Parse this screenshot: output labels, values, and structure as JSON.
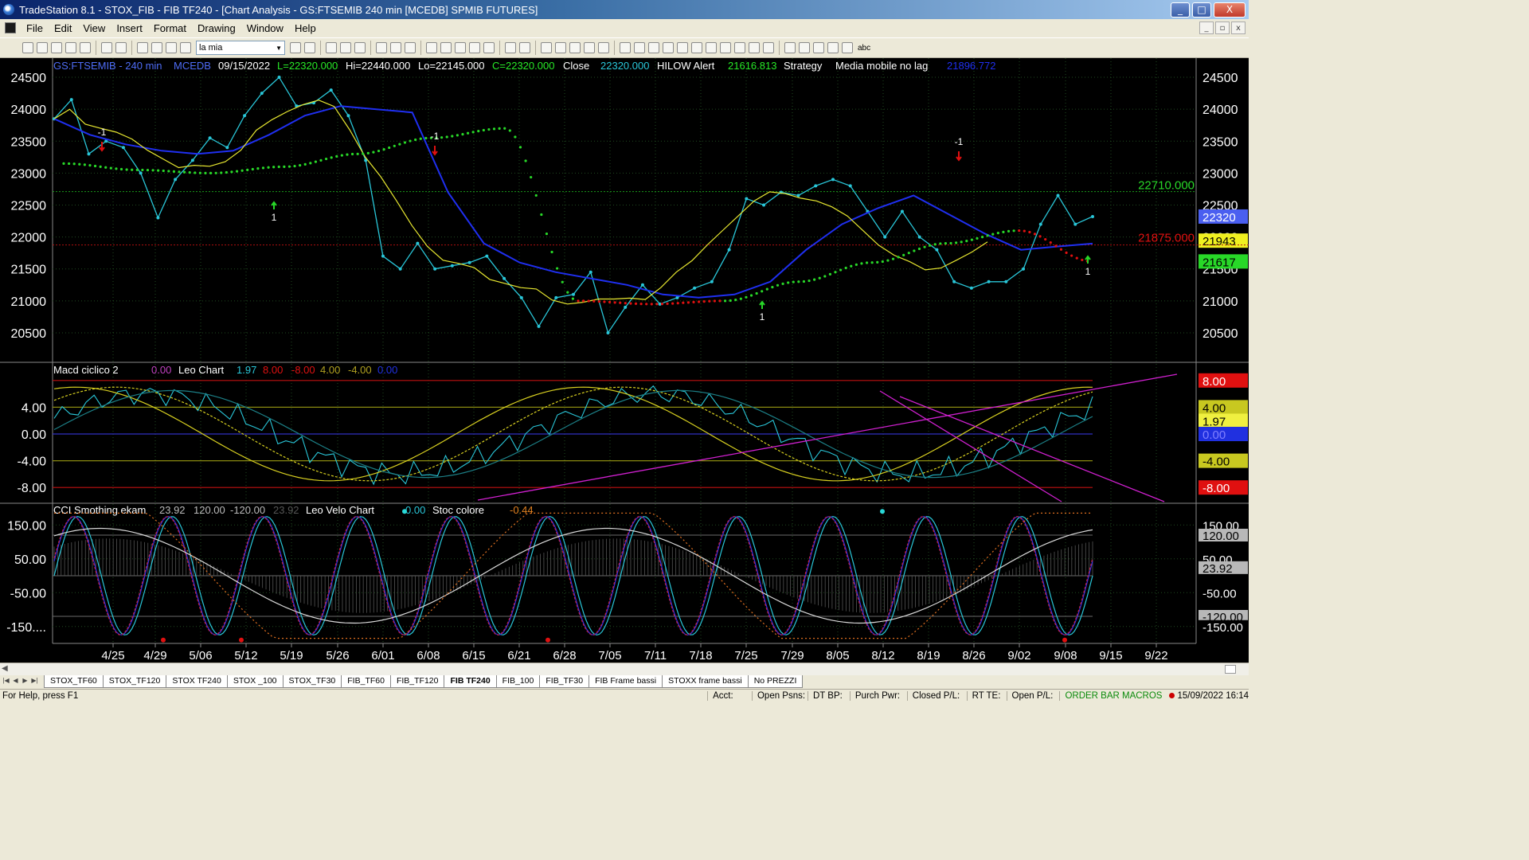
{
  "window": {
    "title": "TradeStation 8.1 - STOX_FIB - FIB TF240 - [Chart Analysis - GS:FTSEMIB  240 min  [MCEDB] SPMIB FUTURES]",
    "min_glyph": "_",
    "max_glyph": "□",
    "close_glyph": "X"
  },
  "menu": {
    "items": [
      "File",
      "Edit",
      "View",
      "Insert",
      "Format",
      "Drawing",
      "Window",
      "Help"
    ],
    "mdi_controls": [
      "_",
      "▫",
      "x"
    ]
  },
  "toolbar": {
    "symbol_dropdown": "la mia",
    "dropdown_arrow": "▼",
    "text_tool": "abc"
  },
  "price_panel": {
    "header": {
      "symbol": "GS:FTSEMIB - 240 min",
      "source": "MCEDB",
      "date": "09/15/2022",
      "low": "L=22320.000",
      "high": "Hi=22440.000",
      "lo": "Lo=22145.000",
      "close_val": "C=22320.000",
      "close_label": "Close",
      "close_value": "22320.000",
      "hilow_label": "HILOW Alert",
      "hilow_value": "21616.813",
      "strategy_label": "Strategy",
      "media_label": "Media mobile no lag",
      "media_value": "21896.772"
    },
    "y_ticks": [
      "24500",
      "24000",
      "23500",
      "23000",
      "22500",
      "22000",
      "21500",
      "21000",
      "20500"
    ],
    "line_labels": {
      "upper": "22710.000",
      "lower": "21875.000"
    },
    "right_markers": [
      "22320",
      "21943",
      "21617"
    ],
    "signal_labels": [
      "-1",
      "1",
      "-1",
      "1",
      "-1",
      "1"
    ]
  },
  "macd_panel": {
    "header": {
      "name": "Macd ciclico 2",
      "v1": "0.00",
      "leo": "Leo Chart",
      "v2": "1.97",
      "v3": "8.00",
      "v4": "-8.00",
      "v5": "4.00",
      "v6": "-4.00",
      "v7": "0.00"
    },
    "y_ticks": [
      "4.00",
      "0.00",
      "-4.00",
      "-8.00"
    ],
    "right_markers": [
      "8.00",
      "4.00",
      "1.97",
      "0.00",
      "-4.00",
      "-8.00"
    ]
  },
  "cci_panel": {
    "header": {
      "name": "CCI Smothing ekam",
      "v1": "23.92",
      "v2": "120.00",
      "v3": "-120.00",
      "v4": "23.92",
      "leo": "Leo Velo Chart",
      "v5": "0.00",
      "stoc": "Stoc colore",
      "v6": "-0.44"
    },
    "y_ticks": [
      "150.00",
      "50.00",
      "-50.00",
      "-150...."
    ],
    "right_markers": [
      "150.00",
      "120.00",
      "50.00",
      "23.92",
      "-50.00",
      "-120.00",
      "-150.00"
    ]
  },
  "x_axis": [
    "4/25",
    "4/29",
    "5/06",
    "5/12",
    "5/19",
    "5/26",
    "6/01",
    "6/08",
    "6/15",
    "6/21",
    "6/28",
    "7/05",
    "7/11",
    "7/18",
    "7/25",
    "7/29",
    "8/05",
    "8/12",
    "8/19",
    "8/26",
    "9/02",
    "9/08",
    "9/15",
    "9/22"
  ],
  "sheet_tabs": [
    "STOX_TF60",
    "STOX_TF120",
    "STOX TF240",
    "STOX _100",
    "STOX_TF30",
    "FIB_TF60",
    "FIB_TF120",
    "FIB TF240",
    "FIB_100",
    "FIB_TF30",
    "FIB Frame bassi",
    "STOXX frame bassi",
    "No PREZZI"
  ],
  "active_tab": "FIB TF240",
  "status": {
    "help": "For Help, press F1",
    "fields": [
      "Acct:",
      "Open Psns:",
      "DT BP:",
      "Purch Pwr:",
      "Closed P/L:",
      "RT TE:",
      "Open P/L:"
    ],
    "macros": "ORDER BAR  MACROS",
    "datetime": "15/09/2022 16:14"
  },
  "colors": {
    "price_cyan": "#29c6d8",
    "ma_blue": "#1f2ff0",
    "ma_yellow": "#e8e830",
    "dots_red": "#e01010",
    "dots_green": "#28d828",
    "trend_magenta": "#d020d0",
    "grid": "#2a3a2a"
  },
  "chart_data": {
    "type": "line",
    "x_labels": [
      "4/25",
      "4/29",
      "5/06",
      "5/12",
      "5/19",
      "5/26",
      "6/01",
      "6/08",
      "6/15",
      "6/21",
      "6/28",
      "7/05",
      "7/11",
      "7/18",
      "7/25",
      "7/29",
      "8/05",
      "8/12",
      "8/19",
      "8/26",
      "9/02",
      "9/08",
      "9/15",
      "9/22"
    ],
    "price_ylim": [
      20250,
      24750
    ],
    "series": [
      {
        "name": "GS:FTSEMIB",
        "values": [
          23850,
          24150,
          23300,
          23500,
          23400,
          23000,
          22300,
          22900,
          23200,
          23550,
          23400,
          23900,
          24250,
          24500,
          24050,
          24100,
          24300,
          23900,
          23200,
          21700,
          21500,
          21900,
          21500,
          21550,
          21600,
          21700,
          21350,
          21050,
          20600,
          21050,
          21100,
          21450,
          20500,
          20900,
          21250,
          20950,
          21050,
          21200,
          21300,
          21800,
          22600,
          22500,
          22700,
          22650,
          22800,
          22900,
          22800,
          22400,
          22000,
          22400,
          22000,
          21800,
          21300,
          21200,
          21300,
          21300,
          21500,
          22200,
          22650,
          22200,
          22320
        ]
      },
      {
        "name": "Media mobile no lag",
        "values": [
          23850,
          23600,
          23450,
          23350,
          23300,
          23350,
          23600,
          23900,
          24050,
          24000,
          23950,
          22700,
          21900,
          21600,
          21450,
          21350,
          21250,
          21100,
          21050,
          21100,
          21300,
          21800,
          22200,
          22450,
          22650,
          22350,
          22050,
          21800,
          21850,
          21897
        ]
      },
      {
        "name": "HILOW Alert",
        "values": [
          23150,
          23050,
          23000,
          23100,
          23300,
          23550,
          23700,
          21000,
          20950,
          21000,
          21300,
          21600,
          21900,
          22100,
          21617
        ]
      }
    ],
    "macd_ylim": [
      -10,
      10
    ],
    "cci_ylim": [
      -200,
      200
    ]
  }
}
